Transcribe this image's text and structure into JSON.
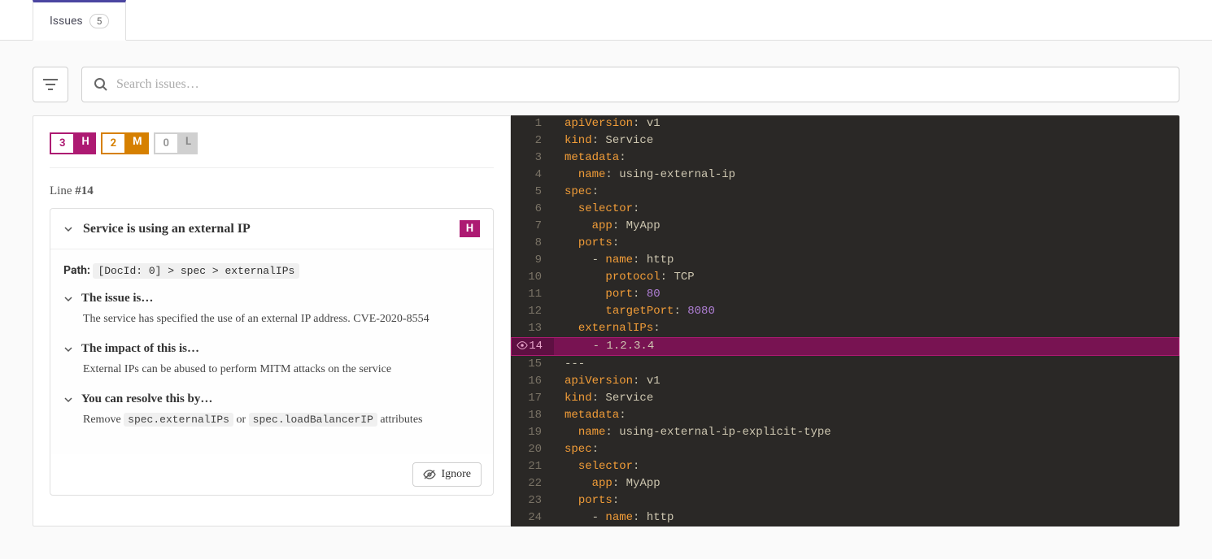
{
  "tab": {
    "label": "Issues",
    "count": "5"
  },
  "search": {
    "placeholder": "Search issues…"
  },
  "severity": {
    "high": {
      "count": "3",
      "letter": "H"
    },
    "medium": {
      "count": "2",
      "letter": "M"
    },
    "low": {
      "count": "0",
      "letter": "L"
    }
  },
  "line_ref": {
    "prefix": "Line ",
    "num": "#14"
  },
  "issue": {
    "title": "Service is using an external IP",
    "sev_letter": "H",
    "path_label": "Path: ",
    "path_value": "[DocId: 0] > spec > externalIPs",
    "sec1": {
      "title": "The issue is…",
      "text": "The service has specified the use of an external IP address. CVE-2020-8554"
    },
    "sec2": {
      "title": "The impact of this is…",
      "text": "External IPs can be abused to perform MITM attacks on the service"
    },
    "sec3": {
      "title": "You can resolve this by…",
      "pre": "Remove ",
      "code1": "spec.externalIPs",
      "mid": " or ",
      "code2": "spec.loadBalancerIP",
      "post": " attributes"
    },
    "ignore": "Ignore"
  },
  "code": {
    "highlight_line": 14,
    "lines": [
      {
        "n": 1,
        "t": [
          [
            "key",
            "apiVersion"
          ],
          [
            "punc",
            ":"
          ],
          [
            "str",
            " v1"
          ]
        ]
      },
      {
        "n": 2,
        "t": [
          [
            "key",
            "kind"
          ],
          [
            "punc",
            ":"
          ],
          [
            "str",
            " Service"
          ]
        ]
      },
      {
        "n": 3,
        "t": [
          [
            "key",
            "metadata"
          ],
          [
            "punc",
            ":"
          ]
        ]
      },
      {
        "n": 4,
        "t": [
          [
            "str",
            "  "
          ],
          [
            "key",
            "name"
          ],
          [
            "punc",
            ":"
          ],
          [
            "str",
            " using-external-ip"
          ]
        ]
      },
      {
        "n": 5,
        "t": [
          [
            "key",
            "spec"
          ],
          [
            "punc",
            ":"
          ]
        ]
      },
      {
        "n": 6,
        "t": [
          [
            "str",
            "  "
          ],
          [
            "key",
            "selector"
          ],
          [
            "punc",
            ":"
          ]
        ]
      },
      {
        "n": 7,
        "t": [
          [
            "str",
            "    "
          ],
          [
            "key",
            "app"
          ],
          [
            "punc",
            ":"
          ],
          [
            "str",
            " MyApp"
          ]
        ]
      },
      {
        "n": 8,
        "t": [
          [
            "str",
            "  "
          ],
          [
            "key",
            "ports"
          ],
          [
            "punc",
            ":"
          ]
        ]
      },
      {
        "n": 9,
        "t": [
          [
            "str",
            "    "
          ],
          [
            "punc",
            "-"
          ],
          [
            "str",
            " "
          ],
          [
            "key",
            "name"
          ],
          [
            "punc",
            ":"
          ],
          [
            "str",
            " http"
          ]
        ]
      },
      {
        "n": 10,
        "t": [
          [
            "str",
            "      "
          ],
          [
            "key",
            "protocol"
          ],
          [
            "punc",
            ":"
          ],
          [
            "str",
            " TCP"
          ]
        ]
      },
      {
        "n": 11,
        "t": [
          [
            "str",
            "      "
          ],
          [
            "key",
            "port"
          ],
          [
            "punc",
            ":"
          ],
          [
            "str",
            " "
          ],
          [
            "num",
            "80"
          ]
        ]
      },
      {
        "n": 12,
        "t": [
          [
            "str",
            "      "
          ],
          [
            "key",
            "targetPort"
          ],
          [
            "punc",
            ":"
          ],
          [
            "str",
            " "
          ],
          [
            "num",
            "8080"
          ]
        ]
      },
      {
        "n": 13,
        "t": [
          [
            "str",
            "  "
          ],
          [
            "key",
            "externalIPs"
          ],
          [
            "punc",
            ":"
          ]
        ]
      },
      {
        "n": 14,
        "t": [
          [
            "str",
            "    "
          ],
          [
            "punc",
            "-"
          ],
          [
            "str",
            " 1.2.3.4"
          ]
        ]
      },
      {
        "n": 15,
        "t": [
          [
            "punc",
            "---"
          ]
        ]
      },
      {
        "n": 16,
        "t": [
          [
            "key",
            "apiVersion"
          ],
          [
            "punc",
            ":"
          ],
          [
            "str",
            " v1"
          ]
        ]
      },
      {
        "n": 17,
        "t": [
          [
            "key",
            "kind"
          ],
          [
            "punc",
            ":"
          ],
          [
            "str",
            " Service"
          ]
        ]
      },
      {
        "n": 18,
        "t": [
          [
            "key",
            "metadata"
          ],
          [
            "punc",
            ":"
          ]
        ]
      },
      {
        "n": 19,
        "t": [
          [
            "str",
            "  "
          ],
          [
            "key",
            "name"
          ],
          [
            "punc",
            ":"
          ],
          [
            "str",
            " using-external-ip-explicit-type"
          ]
        ]
      },
      {
        "n": 20,
        "t": [
          [
            "key",
            "spec"
          ],
          [
            "punc",
            ":"
          ]
        ]
      },
      {
        "n": 21,
        "t": [
          [
            "str",
            "  "
          ],
          [
            "key",
            "selector"
          ],
          [
            "punc",
            ":"
          ]
        ]
      },
      {
        "n": 22,
        "t": [
          [
            "str",
            "    "
          ],
          [
            "key",
            "app"
          ],
          [
            "punc",
            ":"
          ],
          [
            "str",
            " MyApp"
          ]
        ]
      },
      {
        "n": 23,
        "t": [
          [
            "str",
            "  "
          ],
          [
            "key",
            "ports"
          ],
          [
            "punc",
            ":"
          ]
        ]
      },
      {
        "n": 24,
        "t": [
          [
            "str",
            "    "
          ],
          [
            "punc",
            "-"
          ],
          [
            "str",
            " "
          ],
          [
            "key",
            "name"
          ],
          [
            "punc",
            ":"
          ],
          [
            "str",
            " http"
          ]
        ]
      }
    ]
  }
}
